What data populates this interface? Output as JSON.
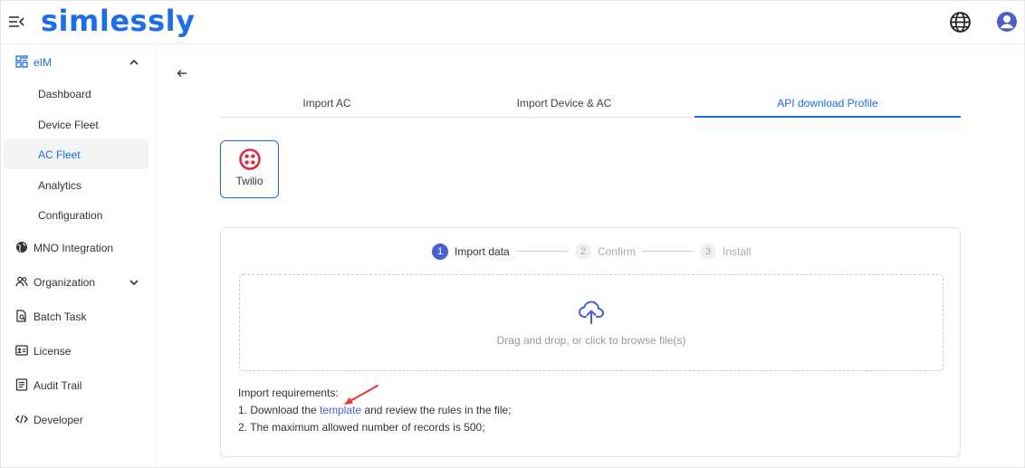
{
  "colors": {
    "brand": "#1c6ee8",
    "accent": "#4b5fd1",
    "step_active": "#4b5fd1",
    "annotation_arrow": "#e53935",
    "twilio_red": "#e5293f"
  },
  "header": {
    "logo_text": "simlessly",
    "menu_icon": "menu-collapse-icon",
    "globe_icon": "globe-icon",
    "user_icon": "user-avatar-icon"
  },
  "sidebar": {
    "group_eim": {
      "label": "eIM",
      "icon": "grid-icon",
      "expanded": true,
      "children": [
        "Dashboard",
        "Device Fleet",
        "AC Fleet",
        "Analytics",
        "Configuration"
      ],
      "selected": "AC Fleet"
    },
    "items": [
      {
        "label": "MNO Integration",
        "icon": "globe-icon"
      },
      {
        "label": "Organization",
        "icon": "users-icon",
        "expandable": true
      },
      {
        "label": "Batch Task",
        "icon": "file-search-icon"
      },
      {
        "label": "License",
        "icon": "id-card-icon"
      },
      {
        "label": "Audit Trail",
        "icon": "list-doc-icon"
      },
      {
        "label": "Developer",
        "icon": "code-icon"
      }
    ]
  },
  "main": {
    "back_icon": "arrow-left-icon",
    "tabs": [
      {
        "label": "Import AC",
        "active": false
      },
      {
        "label": "Import Device & AC",
        "active": false
      },
      {
        "label": "API download Profile",
        "active": true
      }
    ],
    "provider": {
      "label": "Twilio",
      "icon": "twilio-logo-icon",
      "selected": true
    },
    "steps": [
      {
        "num": "1",
        "label": "Import data",
        "active": true
      },
      {
        "num": "2",
        "label": "Confirm",
        "active": false
      },
      {
        "num": "3",
        "label": "Install",
        "active": false
      }
    ],
    "dropzone": {
      "icon": "cloud-upload-icon",
      "hint": "Drag and drop, or click to browse file(s)"
    },
    "requirements": {
      "title": "Import requirements:",
      "line1_prefix": "1. Download the ",
      "line1_link": "template",
      "line1_suffix": " and review the rules in the file;",
      "line2": "2. The maximum allowed number of records is 500;"
    }
  }
}
